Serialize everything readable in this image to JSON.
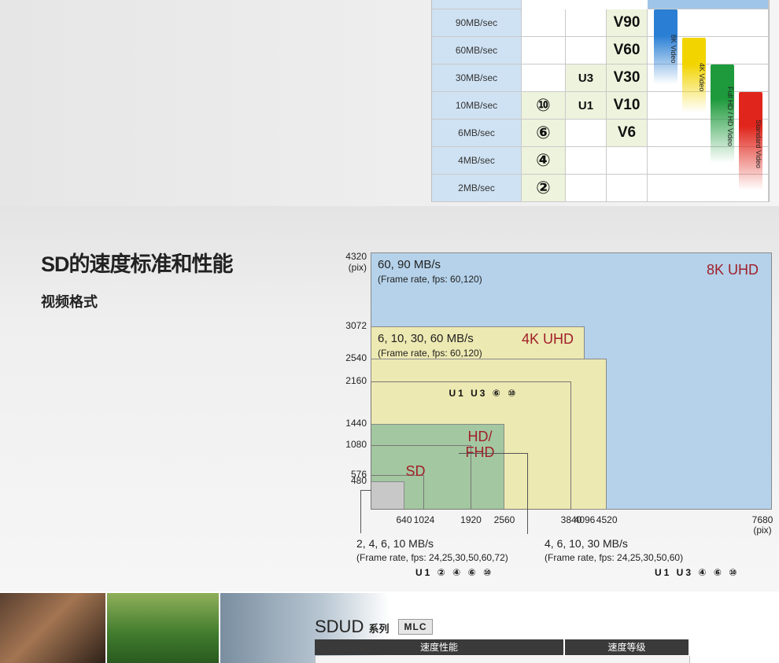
{
  "speed_table": {
    "rates": [
      "90MB/sec",
      "60MB/sec",
      "30MB/sec",
      "10MB/sec",
      "6MB/sec",
      "4MB/sec",
      "2MB/sec"
    ],
    "class_badges": {
      "10MB/sec": "⑩",
      "6MB/sec": "⑥",
      "4MB/sec": "④",
      "2MB/sec": "②"
    },
    "uhs_badges": {
      "30MB/sec": "U3",
      "10MB/sec": "U1"
    },
    "video_badges": {
      "90MB/sec": "V90",
      "60MB/sec": "V60",
      "30MB/sec": "V30",
      "10MB/sec": "V10",
      "6MB/sec": "V6"
    },
    "video_bars": [
      {
        "label": "8K Video",
        "color": "#2a7fd4"
      },
      {
        "label": "4K Video",
        "color": "#f2d400"
      },
      {
        "label": "Full HD / HD Video",
        "color": "#1e9a3c"
      },
      {
        "label": "Standard Video",
        "color": "#e0261c"
      }
    ]
  },
  "section": {
    "title": "SD的速度标准和性能",
    "subtitle": "视频格式"
  },
  "chart_data": {
    "type": "area",
    "y_unit_label": [
      "4320",
      "(pix)"
    ],
    "y_ticks": [
      480,
      576,
      1080,
      1440,
      2160,
      2540,
      3072
    ],
    "x_ticks": [
      640,
      1024,
      1920,
      2560,
      3840,
      4096,
      4520
    ],
    "x_end_label": [
      "7680",
      "(pix)"
    ],
    "xlim": [
      0,
      7680
    ],
    "ylim": [
      0,
      4320
    ],
    "regions": [
      {
        "name": "8K UHD",
        "w": 7680,
        "h": 4320,
        "color": "#b5d2ea",
        "rates": "60, 90 MB/s",
        "fps": "(Frame rate, fps: 60,120)"
      },
      {
        "name": "4K UHD",
        "w": 4096,
        "h": 3072,
        "color": "#ede9b2",
        "rates": "6, 10, 30, 60 MB/s",
        "fps": "(Frame rate, fps: 60,120)",
        "icons": "U1 U3 ⑥ ⑩"
      },
      {
        "name": "4K UHD-b",
        "w": 4520,
        "h": 2540,
        "color": "#ede9b2"
      },
      {
        "name": "HD/\nFHD",
        "w": 2560,
        "h": 1440,
        "color": "#a3c7a0"
      },
      {
        "name": "SD",
        "w": 640,
        "h": 480,
        "color": "#c8c8c8"
      }
    ],
    "sub_outlines": [
      {
        "w": 3840,
        "h": 2160
      },
      {
        "w": 1920,
        "h": 1080
      },
      {
        "w": 1024,
        "h": 576
      }
    ],
    "bottom_notes": [
      {
        "rates": "2, 4, 6, 10 MB/s",
        "fps": "(Frame rate, fps: 24,25,30,50,60,72)",
        "icons": "U1  ② ④ ⑥ ⑩"
      },
      {
        "rates": "4, 6, 10, 30 MB/s",
        "fps": "(Frame rate, fps: 24,25,30,50,60)",
        "icons": "U1 U3  ④ ⑥ ⑩"
      }
    ]
  },
  "bottom": {
    "product": "SDUD",
    "series": "系列",
    "badge": "MLC",
    "col1": "速度性能",
    "col2": "速度等级"
  }
}
